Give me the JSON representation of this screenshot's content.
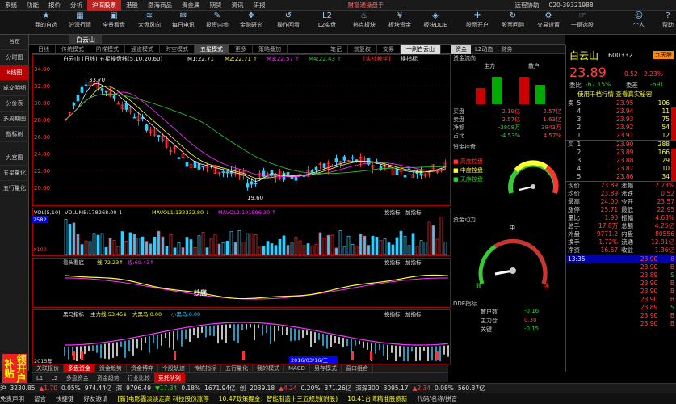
{
  "menu": {
    "items": [
      "系统",
      "功能",
      "报价",
      "分析",
      "沪深股票",
      "港股",
      "渤海商品",
      "贵金属",
      "期货",
      "资讯",
      "研报"
    ],
    "center": "财富通操盘手",
    "remote": "远程协助",
    "phone": "020-39321988"
  },
  "toolbar": {
    "buttons": [
      {
        "label": "我的自选",
        "icon": "★"
      },
      {
        "label": "沪深行情",
        "icon": "▦"
      },
      {
        "label": "全景看盘",
        "icon": "▣"
      },
      {
        "label": "大盘风向",
        "icon": "≋"
      },
      {
        "label": "每日电讯",
        "icon": "✉"
      },
      {
        "label": "投资内参",
        "icon": "✎"
      },
      {
        "label": "金融研究",
        "icon": "❖"
      },
      {
        "label": "操作回看",
        "icon": "↺"
      },
      {
        "label": "L2实盘",
        "icon": "L2"
      },
      {
        "label": "热点板块",
        "icon": "♨"
      },
      {
        "label": "板块资金",
        "icon": "¥"
      },
      {
        "label": "板块DDE",
        "icon": "◈"
      },
      {
        "label": "股票开户",
        "icon": "✚"
      },
      {
        "label": "股票回购",
        "icon": "↻"
      },
      {
        "label": "交易设置",
        "icon": "⚙"
      },
      {
        "label": "一键选股",
        "icon": "☞"
      },
      {
        "label": "个人",
        "icon": "☺"
      },
      {
        "label": "帮助",
        "icon": "?"
      }
    ]
  },
  "sidebar": {
    "items": [
      "首页",
      "分时图",
      "K线图",
      "成交明细",
      "分价表",
      "多周期图",
      "指标树",
      "九宫图",
      "五星量化",
      "五行量化"
    ],
    "active": 2
  },
  "page_tab": "白云山",
  "top_tabs": {
    "left": [
      "日线",
      "传统模式",
      "阶梯模式",
      "通道模式",
      "时空模式",
      "五星模式",
      "更多"
    ],
    "right": [
      "笔记",
      "前复权",
      "交易",
      "一刷白云山"
    ],
    "indicator": "策略叠加"
  },
  "main": {
    "title": "白云山",
    "period": "(日线)",
    "indicator": "五星操盘线(5,10,20,60)",
    "ma": "M1:22.71",
    "ma2": "M2:22.71 ↑",
    "ma3": "M3:22.57 ↑",
    "ma4": "M4:22.43 ↑",
    "strategy": "[实战教学]",
    "switch": "换指标",
    "hi_label": "33.70",
    "lo_label": "19.60",
    "yticks": [
      "34.00",
      "32.00",
      "30.00",
      "28.00",
      "26.00",
      "24.00",
      "22.00",
      "20.00"
    ]
  },
  "vol": {
    "label": "VOL(5,10)",
    "volume": "VOLUME:178268.00 ↓",
    "mavol1": "MAVOL1:132332.80 ↓",
    "mavol2": "MAVOL2:101596.30 ↑",
    "switch": "换指标",
    "add": "加指标",
    "left1": "2582",
    "left2": "X100"
  },
  "panel3": {
    "name": "看头看底",
    "line": "线:72.23↑",
    "short": "段:69.43↑",
    "annot": "抄底",
    "switch": "换指标",
    "add": "加指标"
  },
  "panel4": {
    "name": "黑马指标",
    "l1": "主力线:53.45↓",
    "l2": "大黑马:0.00",
    "l3": "小黑马:0.00",
    "switch": "换指标",
    "add": "加指标",
    "year": "2015年",
    "date": "2016/03/16/三"
  },
  "bottom_tabs": [
    "关联报价",
    "多盘资金",
    "资金趋势",
    "资金博弈",
    "个股轨迹",
    "传统指标",
    "五行量化",
    "我的模式",
    "MACD",
    "另存模式",
    "窗口组合"
  ],
  "bottom_tabs2": [
    "L1",
    "L2",
    "多盘资金",
    "资金趋势",
    "行业比较",
    "竞托队列"
  ],
  "mid": {
    "tabs": [
      "资金",
      "L2动态",
      "财务"
    ],
    "flow_title": "资金流向",
    "main_in": "主力",
    "retail": "散户",
    "rows": [
      [
        "买盘",
        "2.19亿",
        "2.57亿"
      ],
      [
        "卖盘",
        "2.57亿",
        "1.63亿"
      ],
      [
        "净额",
        "-3808万",
        "3843万"
      ],
      [
        "占比",
        "-4.53%",
        "4.57%"
      ]
    ],
    "gauge_title": "资金控盘",
    "legend": [
      "高度控盘",
      "中度控盘",
      "无序控盘"
    ],
    "power_title": "资金动力",
    "mid_label": "中",
    "weak": "弱",
    "strong": "强",
    "dde_title": "DDE指标",
    "dde": [
      [
        "散户数",
        "-0.16"
      ],
      [
        "主力仓",
        "0.30"
      ],
      [
        "关键",
        "-0.15"
      ]
    ]
  },
  "quote": {
    "name": "白云山",
    "code": "600332",
    "badge": "九天股",
    "price": "23.89",
    "change": "0.52",
    "pct": "2.23%",
    "wei_label": "委比",
    "wei": "-67.15%",
    "weic_label": "委差",
    "weic": "-691",
    "promo": "使用千档行情 查看真实秘密",
    "sell": [
      [
        "卖",
        "5",
        "23.95",
        "106"
      ],
      [
        "",
        "4",
        "23.94",
        "11"
      ],
      [
        "",
        "3",
        "23.93",
        "75"
      ],
      [
        "",
        "2",
        "23.92",
        "54"
      ],
      [
        "",
        "1",
        "23.91",
        "12"
      ]
    ],
    "buy": [
      [
        "买",
        "1",
        "23.90",
        "288"
      ],
      [
        "",
        "2",
        "23.89",
        "166"
      ],
      [
        "",
        "3",
        "23.88",
        "29"
      ],
      [
        "",
        "4",
        "23.87",
        "10"
      ],
      [
        "",
        "5",
        "23.86",
        "34"
      ]
    ],
    "stats": [
      [
        "现价",
        "23.89",
        "涨幅",
        "2.23%"
      ],
      [
        "均价",
        "23.89",
        "涨跌",
        "0.52"
      ],
      [
        "最高",
        "24.00",
        "今开",
        "23.57"
      ],
      [
        "涨停",
        "25.71",
        "最低",
        "22.95"
      ],
      [
        "量比",
        "1.90",
        "振幅",
        "4.63%"
      ],
      [
        "总手",
        "17.8万",
        "总额",
        "4.25亿"
      ],
      [
        "外盘",
        "9771.2",
        "内盘",
        "80556"
      ],
      [
        "换手",
        "1.72%",
        "流通",
        "12.91亿"
      ],
      [
        "净资",
        "16.67",
        "收益",
        "1.36亿"
      ]
    ],
    "ticks": [
      [
        "13:35",
        "23.90",
        "8"
      ],
      [
        "",
        "23.90",
        "B"
      ],
      [
        "",
        "23.89",
        "S"
      ],
      [
        "",
        "23.90",
        "B"
      ],
      [
        "",
        "23.90",
        "B"
      ],
      [
        "",
        "23.90",
        "B"
      ],
      [
        "",
        "23.89",
        "S"
      ],
      [
        "",
        "23.90",
        "B"
      ],
      [
        "",
        "23.90",
        "B"
      ]
    ]
  },
  "status1": {
    "items": [
      "沪",
      "3230.85",
      "▲1.70",
      "0.05%",
      "974.44亿",
      "深",
      "9796.49",
      "▼17.34",
      "0.18%",
      "1671.94亿",
      "创",
      "2039.18",
      "▲4.24",
      "0.20%",
      "371.26亿",
      "深深300",
      "3095.17",
      "▲2.34",
      "0.08%",
      "560.37亿"
    ]
  },
  "status2": {
    "items": [
      "免责声明",
      "留言",
      "快捷键",
      "好友邀请",
      "[新]电影露淡淡走高 科技股份涨停",
      "10:47政策掘金：智能制造十三五规划(附股)",
      "10:41台湾精准股债新",
      "代码/名称/拼音"
    ]
  },
  "ad": "领开户补贴"
}
